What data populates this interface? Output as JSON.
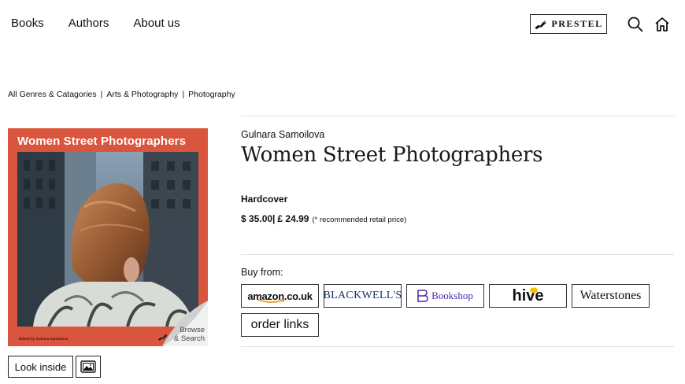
{
  "nav": {
    "items": [
      {
        "label": "Books"
      },
      {
        "label": "Authors"
      },
      {
        "label": "About us"
      }
    ]
  },
  "header": {
    "logo_text": "PRESTEL",
    "search_icon": "search-icon",
    "home_icon": "home-icon"
  },
  "breadcrumb": {
    "items": [
      {
        "label": "All Genres & Catagories"
      },
      {
        "label": "Arts & Photography"
      },
      {
        "label": "Photography"
      }
    ],
    "separator": "|"
  },
  "cover": {
    "title": "Women Street Photographers",
    "editor": "Edited by Gulnara Samoilova",
    "browse_line1": "Browse",
    "browse_line2": "& Search",
    "background_color": "#d9553d"
  },
  "actions": {
    "look_inside_label": "Look inside",
    "gallery_icon": "image-gallery-icon"
  },
  "book": {
    "author": "Gulnara Samoilova",
    "title": "Women Street Photographers",
    "format": "Hardcover",
    "price_usd": "$ 35.00",
    "price_sep": "|",
    "price_gbp": "£ 24.99",
    "price_note": "(* recommended retail price)"
  },
  "buy": {
    "label": "Buy from:",
    "retailers": [
      {
        "name": "amazon.co.uk"
      },
      {
        "name": "BLACKWELL'S"
      },
      {
        "name": "Bookshop"
      },
      {
        "name": "hive"
      },
      {
        "name": "Waterstones"
      },
      {
        "name": "order links"
      }
    ]
  }
}
